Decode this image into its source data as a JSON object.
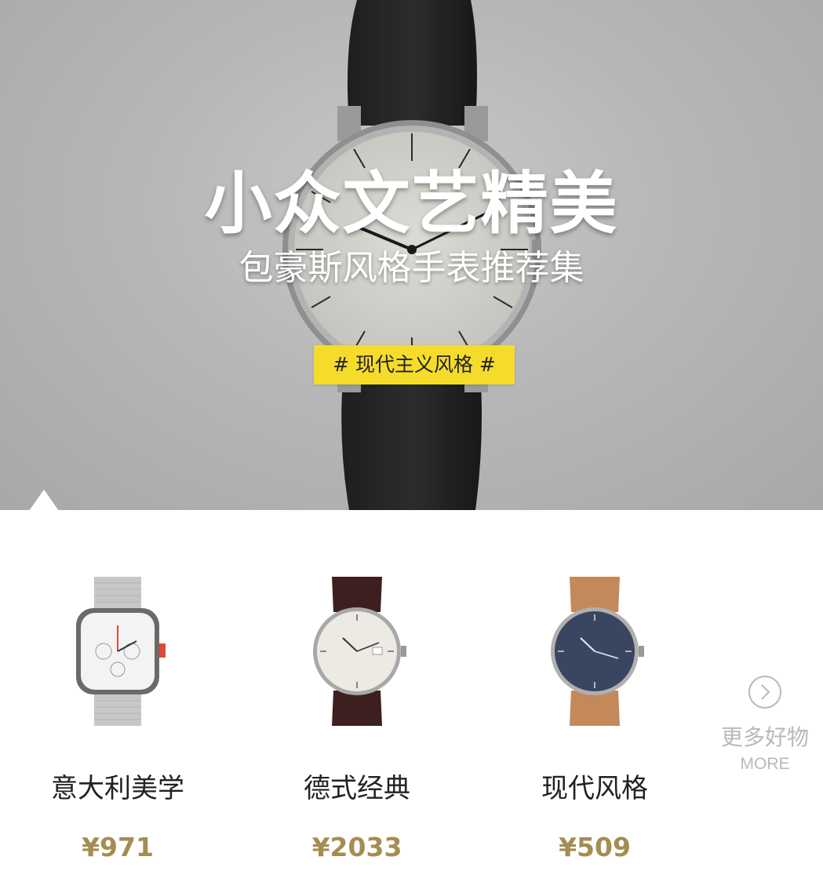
{
  "hero": {
    "title": "小众文艺精美",
    "subtitle": "包豪斯风格手表推荐集",
    "tag": "# 现代主义风格 #",
    "tag_color": "#f5dc2b",
    "icon": "watch-photo"
  },
  "products": [
    {
      "name": "意大利美学",
      "price": "¥971",
      "icon": "silver-mesh-chronograph-watch"
    },
    {
      "name": "德式经典",
      "price": "¥2033",
      "icon": "brown-leather-dress-watch"
    },
    {
      "name": "现代风格",
      "price": "¥509",
      "icon": "tan-strap-navy-dial-watch"
    }
  ],
  "more": {
    "label": "更多好物",
    "sublabel": "MORE",
    "icon": "chevron-right-circle-icon"
  },
  "colors": {
    "price": "#a48d52",
    "accent": "#f5dc2b",
    "muted": "#b9b9b9"
  }
}
